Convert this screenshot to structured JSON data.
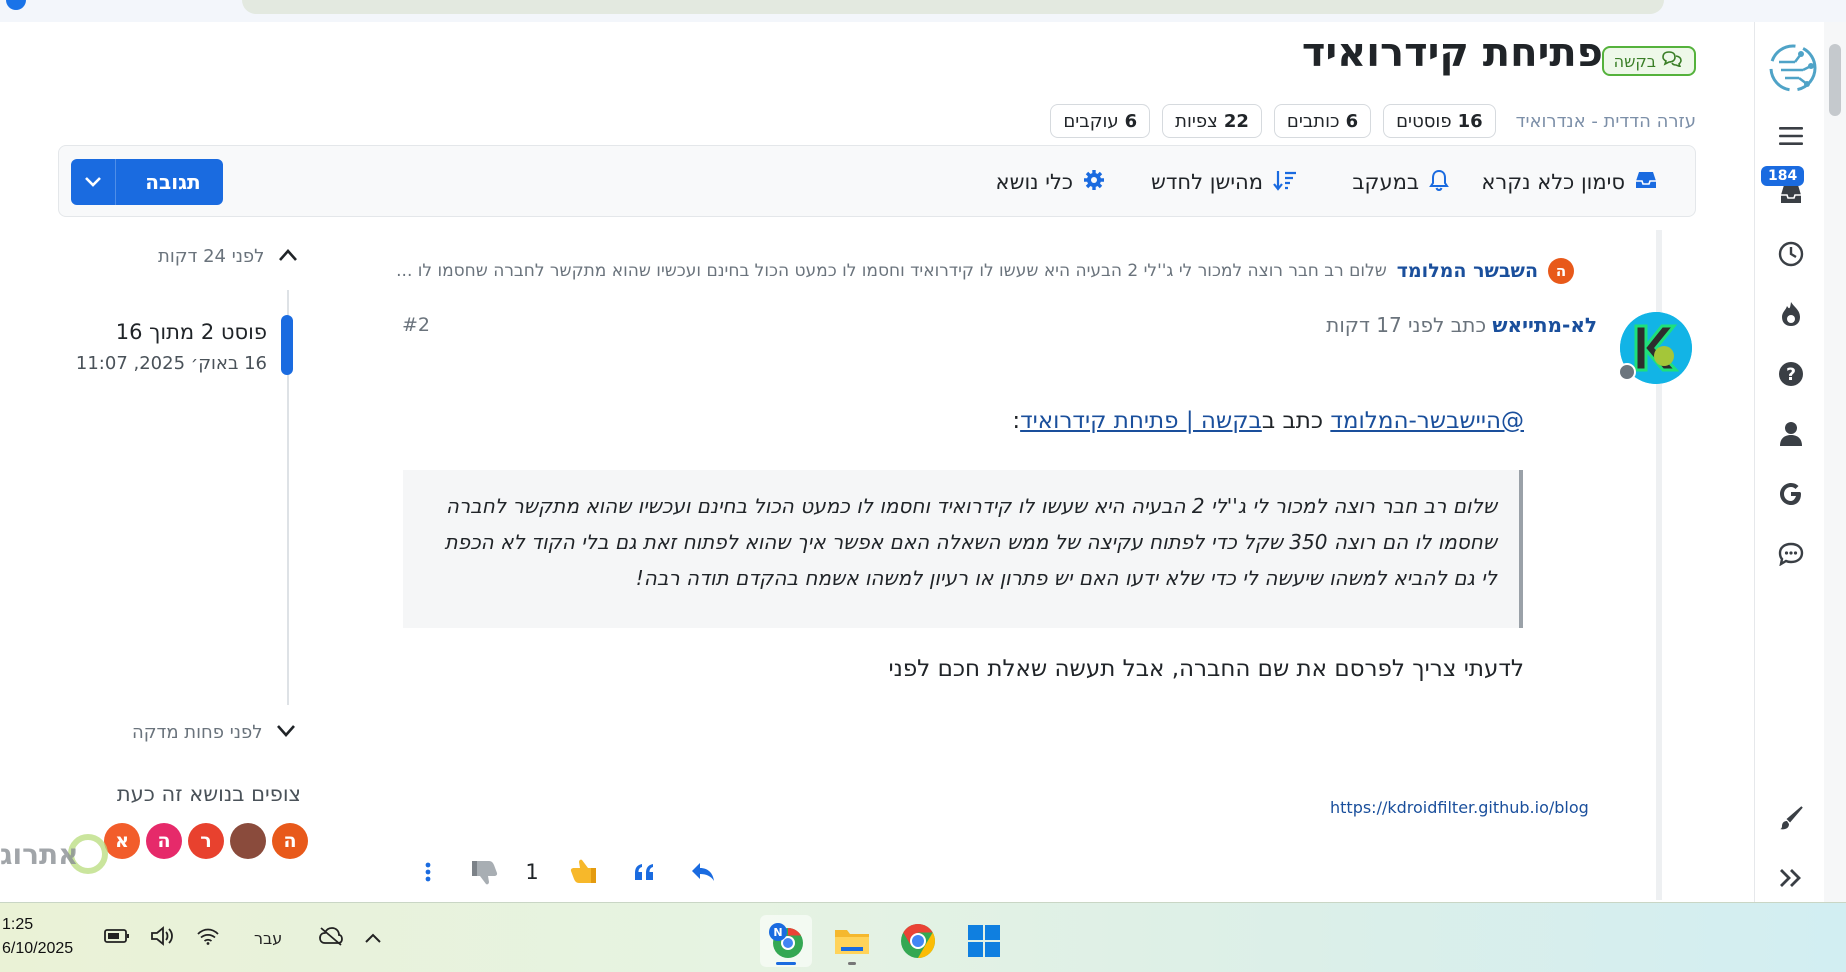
{
  "topic": {
    "title": "פתיחת קידרואיד",
    "tag": "בקשה",
    "category": "עזרה הדדית - אנדרואיד",
    "stats": [
      {
        "num": "16",
        "label": "פוסטים"
      },
      {
        "num": "6",
        "label": "כותבים"
      },
      {
        "num": "22",
        "label": "צפיות"
      },
      {
        "num": "6",
        "label": "עוקבים"
      }
    ]
  },
  "toolbar": {
    "mark_unread": "סימון כלא נקרא",
    "watching": "במעקב",
    "sort": "מהישן לחדש",
    "topic_tools": "כלי נושא",
    "reply": "תגובה"
  },
  "rail": {
    "badge": "184"
  },
  "timeline": {
    "top_time": "לפני 24 דקות",
    "post_position": "פוסט 2 מתוך 16",
    "post_date": "16 באוק׳ 2025, 11:07",
    "bottom_time": "לפני פחות מדקה",
    "viewers_title": "צופים בנושא זה כעת",
    "viewers": [
      {
        "letter": "ה",
        "color": "#e8591a"
      },
      {
        "letter": "",
        "color": "#8a4b3c"
      },
      {
        "letter": "ר",
        "color": "#e8412e"
      },
      {
        "letter": "ה",
        "color": "#e62a6a"
      },
      {
        "letter": "א",
        "color": "#f25d2b"
      }
    ]
  },
  "parent": {
    "avatar_letter": "ה",
    "username": "השבשר המלומד",
    "snippet": "שלום רב חבר רוצה למכור לי ג''לי 2 הבעיה היא שעשו לו קידרואיד וחסמו לו כמעט הכול בחינם ועכשיו שהוא מתקשר לחברה שחסמו לו ..."
  },
  "post": {
    "author": "לא-מתייאש",
    "written_ago": "כתב לפני 17 דקות",
    "number": "#2",
    "quote_user": "@היישבשר-המלומד",
    "quote_mid": "כתב ב",
    "quote_topic": "בקשה | פתיחת קידרואיד",
    "quote_end": ":",
    "quote_text": "שלום רב חבר רוצה למכור לי ג''לי 2 הבעיה היא שעשו לו קידרואיד וחסמו לו כמעט הכול בחינם ועכשיו שהוא מתקשר לחברה שחסמו לו הם רוצה 350 שקל כדי לפתוח עקיצה של ממש השאלה האם אפשר איך שהוא לפתוח זאת גם בלי הקוד לא הכפת לי גם להביא למשהו שיעשה לי כדי שלא ידעו האם יש פתרון או רעיון למשהו אשמח בהקדם תודה רבה!",
    "body": "לדעתי צריך לפרסם את שם החברה, אבל תעשה שאלת חכם לפני",
    "signature": "https://kdroidfilter.github.io/blog",
    "votes": "1"
  },
  "taskbar": {
    "time": "1:25",
    "date": "6/10/2025",
    "language": "עבר"
  },
  "watermark": "אתרוג",
  "colors": {
    "accent": "#1a6be0",
    "link": "#1a4f9c",
    "tag_green": "#55b23c"
  }
}
